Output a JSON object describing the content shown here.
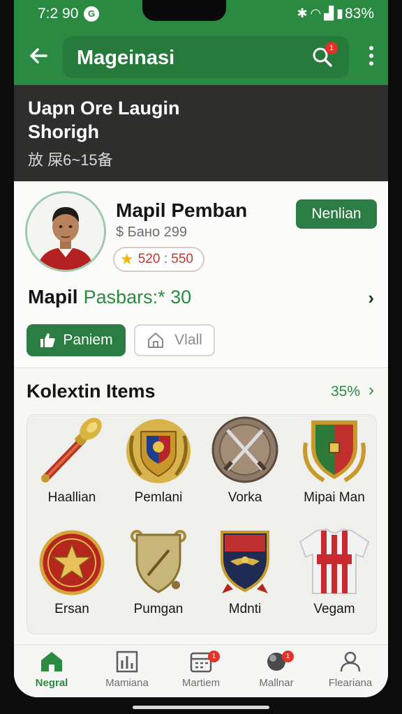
{
  "status_bar": {
    "time": "7:2 90",
    "notification_glyph": "G",
    "battery": "83%",
    "icons": [
      "bluetooth-icon",
      "wifi-icon",
      "signal-icon",
      "battery-icon"
    ]
  },
  "app_bar": {
    "title": "Mageinasi",
    "search_badge": "1",
    "accent": "#2b8a41"
  },
  "banner": {
    "line1": "Uapn Ore Laugin",
    "line2": "Shorigh",
    "subtitle": "放 屎6~15备"
  },
  "profile": {
    "name": "Mapil Pemban",
    "subtitle": "$ Бано 299",
    "points": "520 : 550",
    "follow_label": "Nenlian",
    "stats_name": "Mapil",
    "stats_value": "Pasbars:* 30",
    "like_label": "Paniem",
    "mail_label": "Vlall"
  },
  "collection": {
    "title": "Kolextin Items",
    "percent": "35%",
    "items": [
      {
        "label": "Haallian",
        "icon": "torch-icon"
      },
      {
        "label": "Pemlani",
        "icon": "shield-crest-icon"
      },
      {
        "label": "Vorka",
        "icon": "crossed-swords-coin-icon"
      },
      {
        "label": "Mipai Man",
        "icon": "green-red-crest-icon"
      },
      {
        "label": "Ersan",
        "icon": "star-medal-icon"
      },
      {
        "label": "Pumgan",
        "icon": "bronze-shield-icon"
      },
      {
        "label": "Mdnti",
        "icon": "eagle-shield-icon"
      },
      {
        "label": "Vegam",
        "icon": "jersey-icon"
      }
    ]
  },
  "bottom_nav": {
    "items": [
      {
        "label": "Negral",
        "icon": "home-icon",
        "active": true,
        "badge": ""
      },
      {
        "label": "Mamiana",
        "icon": "chart-icon",
        "active": false,
        "badge": ""
      },
      {
        "label": "Martiem",
        "icon": "calendar-icon",
        "active": false,
        "badge": "1"
      },
      {
        "label": "Mallnar",
        "icon": "ball-icon",
        "active": false,
        "badge": "1"
      },
      {
        "label": "Fleariana",
        "icon": "profile-icon",
        "active": false,
        "badge": ""
      }
    ]
  }
}
